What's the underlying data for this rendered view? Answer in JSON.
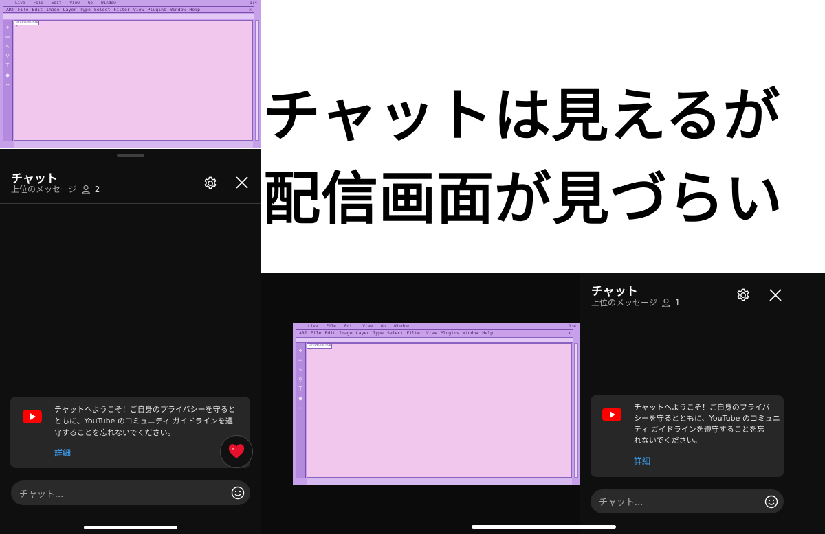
{
  "stream": {
    "status_items": [
      "Live",
      "File",
      "Edit",
      "View",
      "Go",
      "Window"
    ],
    "status_right": "1:4",
    "menu_items": [
      "ART",
      "File",
      "Edit",
      "Image",
      "Layer",
      "Type",
      "Select",
      "Filter",
      "View",
      "Plugins",
      "Window",
      "Help"
    ],
    "close_glyph": "✕",
    "doc_tab": "untitled.PSD  ×"
  },
  "caption": {
    "line1": "チャットは見えるが",
    "line2": "配信画面が見づらい"
  },
  "left_chat": {
    "title": "チャット",
    "subtitle": "上位のメッセージ",
    "viewer_count": "2",
    "welcome_message": "チャットへようこそ！ご自身のプライバシーを守るとともに、YouTube のコミュニティ ガイドラインを遵守することを忘れないでください。",
    "welcome_lines": [
      "チャットへようこそ！ご自身のプライバシーを守ると",
      "ともに、YouTube のコミュニティ ガイドラインを遵",
      "守することを忘れないでください。"
    ],
    "detail_link": "詳細",
    "input_placeholder": "チャット...",
    "reaction_emoji": "❤️"
  },
  "right_chat": {
    "title": "チャット",
    "subtitle": "上位のメッセージ",
    "viewer_count": "1",
    "welcome_lines": [
      "チャットへようこそ！ご自身のプライバ",
      "シーを守るとともに、YouTube のコミュニ",
      "ティ ガイドラインを遵守することを忘",
      "れないでください。"
    ],
    "detail_link": "詳細",
    "input_placeholder": "チャット..."
  },
  "colors": {
    "panel_bg": "#0f0f0f",
    "card_bg": "#272727",
    "link": "#3ea6ff",
    "youtube_red": "#ff0000",
    "stream_pink": "#f1c7ee",
    "stream_purple": "#b88ae0"
  },
  "icons": [
    "gear-icon",
    "close-icon",
    "person-icon",
    "youtube-logo-icon",
    "smiley-icon",
    "heart-icon"
  ]
}
